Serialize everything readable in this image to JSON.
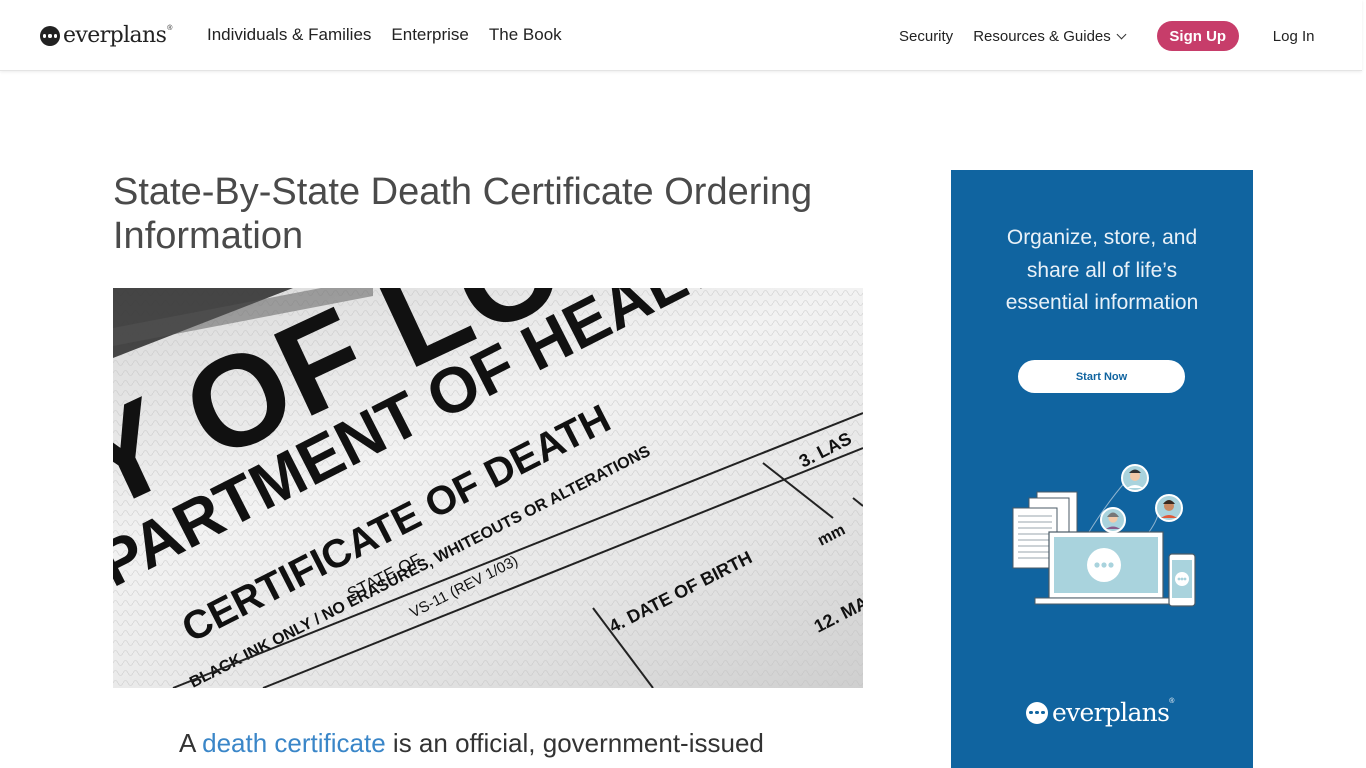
{
  "header": {
    "logo_text": "everplans",
    "logo_mark": "®",
    "nav_left": [
      "Individuals & Families",
      "Enterprise",
      "The Book"
    ],
    "security": "Security",
    "resources": "Resources & Guides",
    "signup": "Sign Up",
    "login": "Log In"
  },
  "article": {
    "title": "State-By-State Death Certificate Ordering Information",
    "hero_lines": [
      "Y OF LO",
      "PARTMENT OF HEALTH",
      "CERTIFICATE OF DEATH",
      "STATE OF",
      "BLACK INK ONLY / NO ERASURES, WHITEOUTS OR ALTERATIONS",
      "VS-11 (REV 1/03)",
      "3. LAS",
      "4. DATE OF BIRTH",
      "mm",
      "12. MA"
    ],
    "intro_prefix": "A ",
    "intro_link": "death certificate",
    "intro_suffix": " is an official, government-issued"
  },
  "ad": {
    "headline_lines": [
      "Organize, store, and",
      "share all of life’s",
      "essential information"
    ],
    "button": "Start Now",
    "logo_text": "everplans",
    "logo_mark": "®"
  },
  "colors": {
    "accent": "#c73d6a",
    "ad_background": "#1064a0",
    "link": "#3a86c8"
  }
}
